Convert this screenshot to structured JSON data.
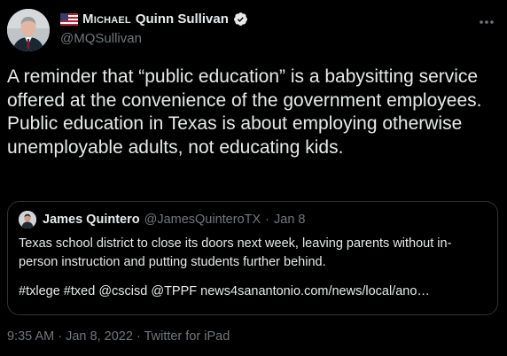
{
  "tweet": {
    "author": {
      "name_first": "Michael",
      "name_rest": "Quinn Sullivan",
      "handle": "@MQSullivan"
    },
    "text": "A reminder that “public education” is a babysitting service offered at the convenience of the government employees. Public education in Texas is about employing otherwise unemployable adults, not educating kids.",
    "quoted": {
      "name": "James Quintero",
      "handle": "@JamesQuinteroTX",
      "separator": "·",
      "date": "Jan 8",
      "text": "Texas school district to close its doors next week, leaving parents without in-person instruction and putting students further behind.",
      "tags": [
        "#txlege",
        "#txed",
        "@cscisd",
        "@TPPF"
      ],
      "link": "news4sanantonio.com/news/local/ano…"
    },
    "footer": {
      "time": "9:35 AM",
      "date": "Jan 8, 2022",
      "source": "Twitter for iPad",
      "separator": "·"
    }
  },
  "icons": {
    "flag": "us-flag-icon",
    "verified": "verified-badge-icon",
    "more": "more-options-icon"
  },
  "colors": {
    "background": "#000000",
    "primary_text": "#e7e9ea",
    "secondary_text": "#71767b",
    "border": "#2f3336",
    "verified": "#e7e9ea"
  }
}
